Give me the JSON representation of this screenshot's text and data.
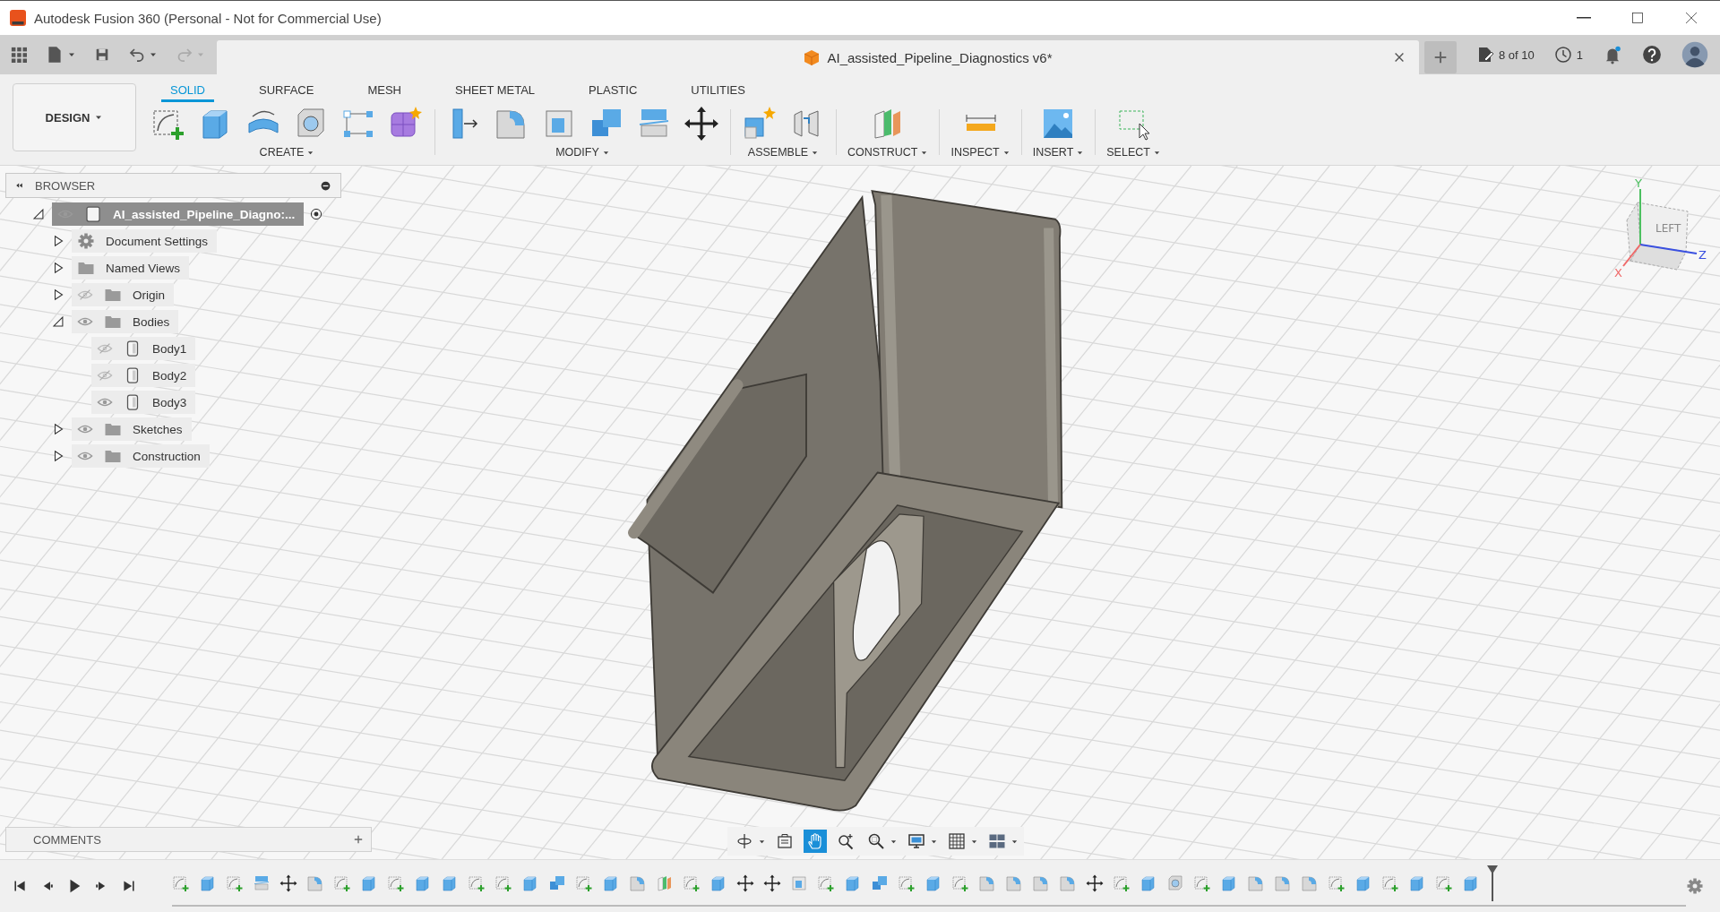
{
  "window": {
    "title": "Autodesk Fusion 360 (Personal - Not for Commercial Use)"
  },
  "document_tab": {
    "title": "AI_assisted_Pipeline_Diagnostics v6*"
  },
  "header": {
    "version_count": "8 of 10",
    "jobs_count": "1"
  },
  "workspace": {
    "label": "DESIGN"
  },
  "toolbar_tabs": [
    {
      "label": "SOLID",
      "selected": true
    },
    {
      "label": "SURFACE",
      "selected": false
    },
    {
      "label": "MESH",
      "selected": false
    },
    {
      "label": "SHEET METAL",
      "selected": false
    },
    {
      "label": "PLASTIC",
      "selected": false
    },
    {
      "label": "UTILITIES",
      "selected": false
    }
  ],
  "tool_groups": [
    {
      "label": "CREATE",
      "tools": [
        {
          "kind": "sketch"
        },
        {
          "kind": "extrude"
        },
        {
          "kind": "revolve"
        },
        {
          "kind": "hole"
        },
        {
          "kind": "pattern"
        },
        {
          "kind": "form"
        }
      ]
    },
    {
      "label": "MODIFY",
      "tools": [
        {
          "kind": "presspull"
        },
        {
          "kind": "fillet"
        },
        {
          "kind": "shell"
        },
        {
          "kind": "combine"
        },
        {
          "kind": "split"
        },
        {
          "kind": "move"
        }
      ]
    },
    {
      "label": "ASSEMBLE",
      "tools": [
        {
          "kind": "component"
        },
        {
          "kind": "joint"
        }
      ]
    },
    {
      "label": "CONSTRUCT",
      "tools": [
        {
          "kind": "plane"
        }
      ]
    },
    {
      "label": "INSPECT",
      "tools": [
        {
          "kind": "measure"
        }
      ]
    },
    {
      "label": "INSERT",
      "tools": [
        {
          "kind": "image"
        }
      ]
    },
    {
      "label": "SELECT",
      "tools": [
        {
          "kind": "select"
        }
      ]
    }
  ],
  "browser": {
    "title": "BROWSER",
    "tree": [
      {
        "label": "AI_assisted_Pipeline_Diagno:...",
        "kind": "component",
        "visible": true,
        "expanded": true,
        "selected": true,
        "children": [
          {
            "label": "Document Settings",
            "kind": "settings",
            "expanded": false,
            "selected": false
          },
          {
            "label": "Named Views",
            "kind": "folder",
            "expanded": false,
            "selected": false
          },
          {
            "label": "Origin",
            "kind": "folder",
            "visible": false,
            "expanded": false,
            "selected": false
          },
          {
            "label": "Bodies",
            "kind": "folder",
            "visible": true,
            "expanded": true,
            "selected": false,
            "children": [
              {
                "label": "Body1",
                "kind": "body",
                "visible": false,
                "selected": false
              },
              {
                "label": "Body2",
                "kind": "body",
                "visible": false,
                "selected": false
              },
              {
                "label": "Body3",
                "kind": "body",
                "visible": true,
                "selected": false
              }
            ]
          },
          {
            "label": "Sketches",
            "kind": "folder",
            "visible": true,
            "expanded": false,
            "selected": false
          },
          {
            "label": "Construction",
            "kind": "folder",
            "visible": true,
            "expanded": false,
            "selected": false
          }
        ]
      }
    ]
  },
  "comments": {
    "title": "COMMENTS"
  },
  "view_cube": {
    "face": "LEFT",
    "axes": [
      {
        "label": "Y"
      },
      {
        "label": "Z"
      },
      {
        "label": "X"
      }
    ]
  },
  "nav_bar": {
    "tools": [
      {
        "kind": "orbit",
        "selected": false
      },
      {
        "kind": "lookat",
        "selected": false
      },
      {
        "kind": "pan",
        "selected": true
      },
      {
        "kind": "zoom",
        "selected": false
      },
      {
        "kind": "zoomwin",
        "selected": false
      },
      {
        "kind": "display",
        "selected": false
      },
      {
        "kind": "grid",
        "selected": false
      },
      {
        "kind": "viewports",
        "selected": false
      }
    ]
  },
  "timeline": {
    "features": [
      {
        "kind": "sketch"
      },
      {
        "kind": "extrude"
      },
      {
        "kind": "sketch"
      },
      {
        "kind": "split"
      },
      {
        "kind": "move"
      },
      {
        "kind": "fillet"
      },
      {
        "kind": "sketch"
      },
      {
        "kind": "extrude"
      },
      {
        "kind": "sketch"
      },
      {
        "kind": "extrude"
      },
      {
        "kind": "extrude"
      },
      {
        "kind": "sketch"
      },
      {
        "kind": "sketch"
      },
      {
        "kind": "extrude"
      },
      {
        "kind": "combine"
      },
      {
        "kind": "sketch"
      },
      {
        "kind": "extrude"
      },
      {
        "kind": "fillet"
      },
      {
        "kind": "plane"
      },
      {
        "kind": "sketch"
      },
      {
        "kind": "extrude"
      },
      {
        "kind": "move"
      },
      {
        "kind": "move"
      },
      {
        "kind": "shell"
      },
      {
        "kind": "sketch"
      },
      {
        "kind": "extrude"
      },
      {
        "kind": "combine"
      },
      {
        "kind": "sketch"
      },
      {
        "kind": "extrude"
      },
      {
        "kind": "sketch"
      },
      {
        "kind": "fillet"
      },
      {
        "kind": "fillet"
      },
      {
        "kind": "fillet"
      },
      {
        "kind": "fillet"
      },
      {
        "kind": "move"
      },
      {
        "kind": "sketch"
      },
      {
        "kind": "extrude"
      },
      {
        "kind": "hole"
      },
      {
        "kind": "sketch"
      },
      {
        "kind": "extrude"
      },
      {
        "kind": "fillet"
      },
      {
        "kind": "fillet"
      },
      {
        "kind": "fillet"
      },
      {
        "kind": "sketch"
      },
      {
        "kind": "extrude"
      },
      {
        "kind": "sketch"
      },
      {
        "kind": "extrude"
      },
      {
        "kind": "sketch"
      },
      {
        "kind": "extrude"
      }
    ]
  }
}
